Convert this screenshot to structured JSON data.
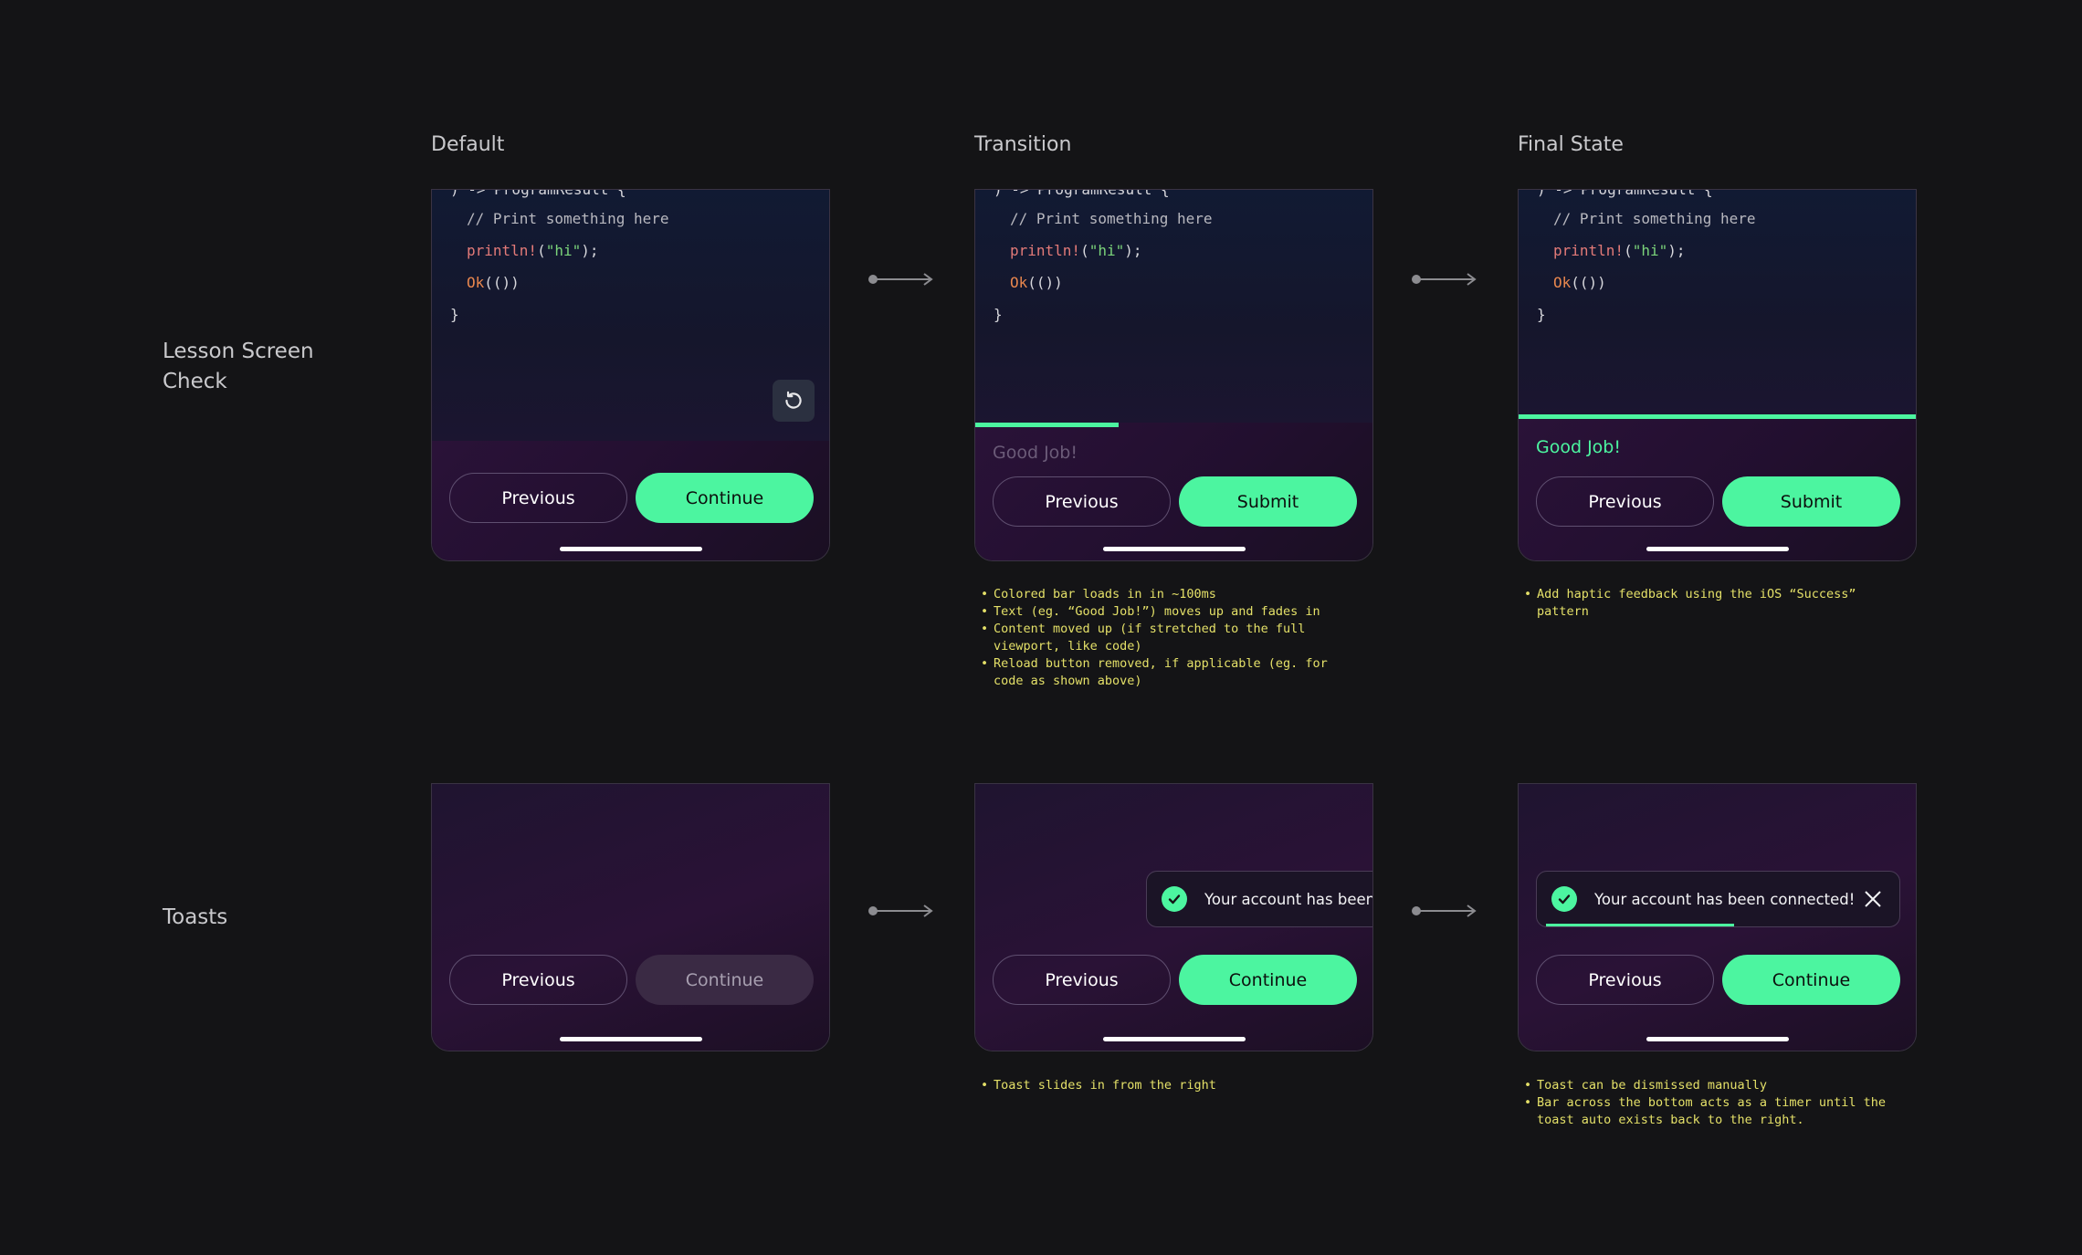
{
  "columns": [
    "Default",
    "Transition",
    "Final State"
  ],
  "rows": {
    "lesson": [
      "Lesson Screen",
      "Check"
    ],
    "toasts": "Toasts"
  },
  "code": {
    "top_line": ") -> ProgramResult {",
    "comment": "// Print something here",
    "fn": "println!",
    "paren_open": "(",
    "str": "\"hi\"",
    "paren_close": ");",
    "ok": "Ok",
    "ok_args": "(())",
    "brace": "}"
  },
  "buttons": {
    "previous": "Previous",
    "continue": "Continue",
    "submit": "Submit"
  },
  "feedback": "Good Job!",
  "progress": {
    "transition_load_fraction": 0.36,
    "toast_timer_fraction": 0.52
  },
  "toast": {
    "full": "Your account has been connected!",
    "partial": "Your account has been co"
  },
  "notes": {
    "transition": [
      "Colored bar loads in in ~100ms",
      "Text (eg. “Good Job!”) moves up and fades in",
      "Content moved up (if stretched to the full viewport, like code)",
      "Reload button removed, if applicable (eg. for code as shown above)"
    ],
    "final": [
      "Add haptic feedback using the iOS “Success” pattern"
    ],
    "toast_transition": [
      "Toast slides in from the right"
    ],
    "toast_final": [
      "Toast can be dismissed manually",
      "Bar across the bottom acts as a timer until the toast auto exists back to the right."
    ]
  },
  "colors": {
    "accent": "#4cf5a0",
    "note": "#e4e068",
    "background": "#141416"
  },
  "icons": {
    "reload": "reload-icon",
    "check": "check-icon",
    "close": "close-icon",
    "arrow": "arrow-right-icon"
  }
}
